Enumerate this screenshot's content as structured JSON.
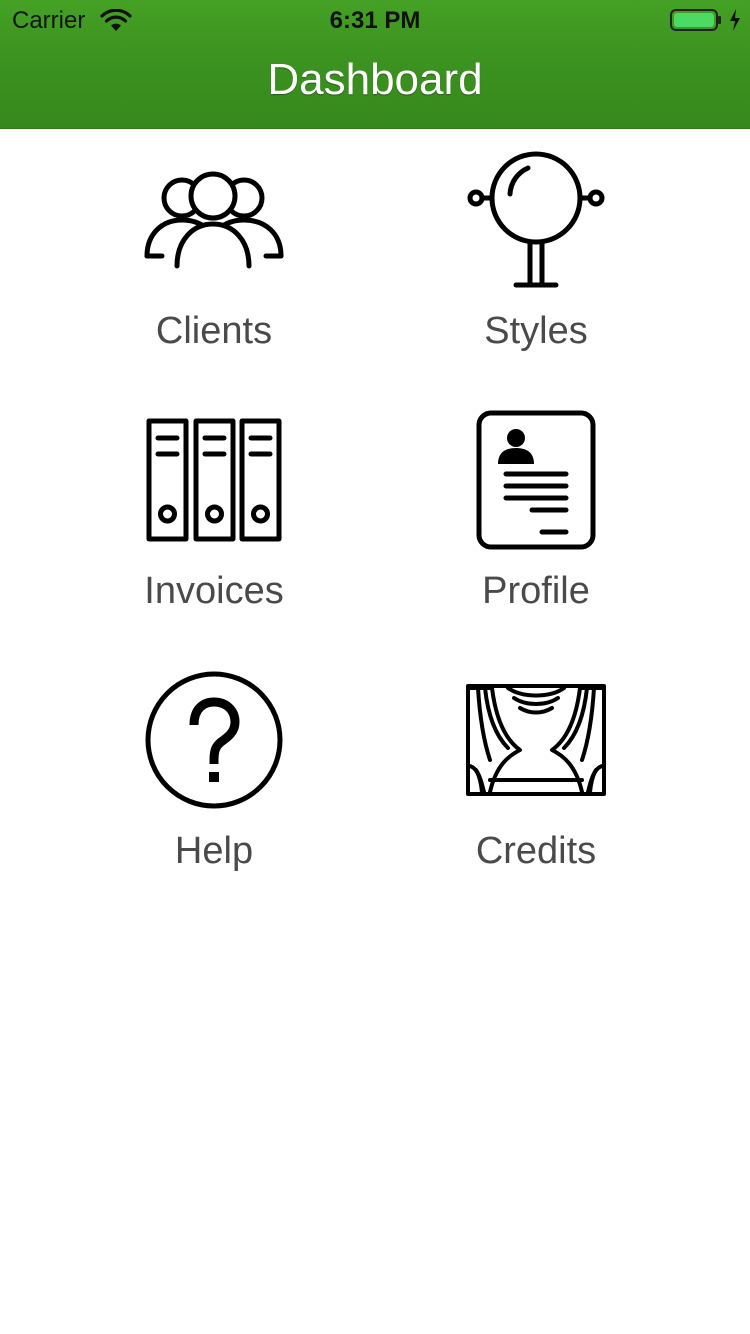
{
  "status_bar": {
    "carrier": "Carrier",
    "time": "6:31 PM",
    "battery_color": "#4cd964"
  },
  "header": {
    "title": "Dashboard",
    "background_color": "#3c9320"
  },
  "menu": {
    "items": [
      {
        "label": "Clients",
        "icon": "clients-icon"
      },
      {
        "label": "Styles",
        "icon": "mirror-icon"
      },
      {
        "label": "Invoices",
        "icon": "binders-icon"
      },
      {
        "label": "Profile",
        "icon": "profile-card-icon"
      },
      {
        "label": "Help",
        "icon": "question-circle-icon"
      },
      {
        "label": "Credits",
        "icon": "curtains-icon"
      }
    ]
  }
}
